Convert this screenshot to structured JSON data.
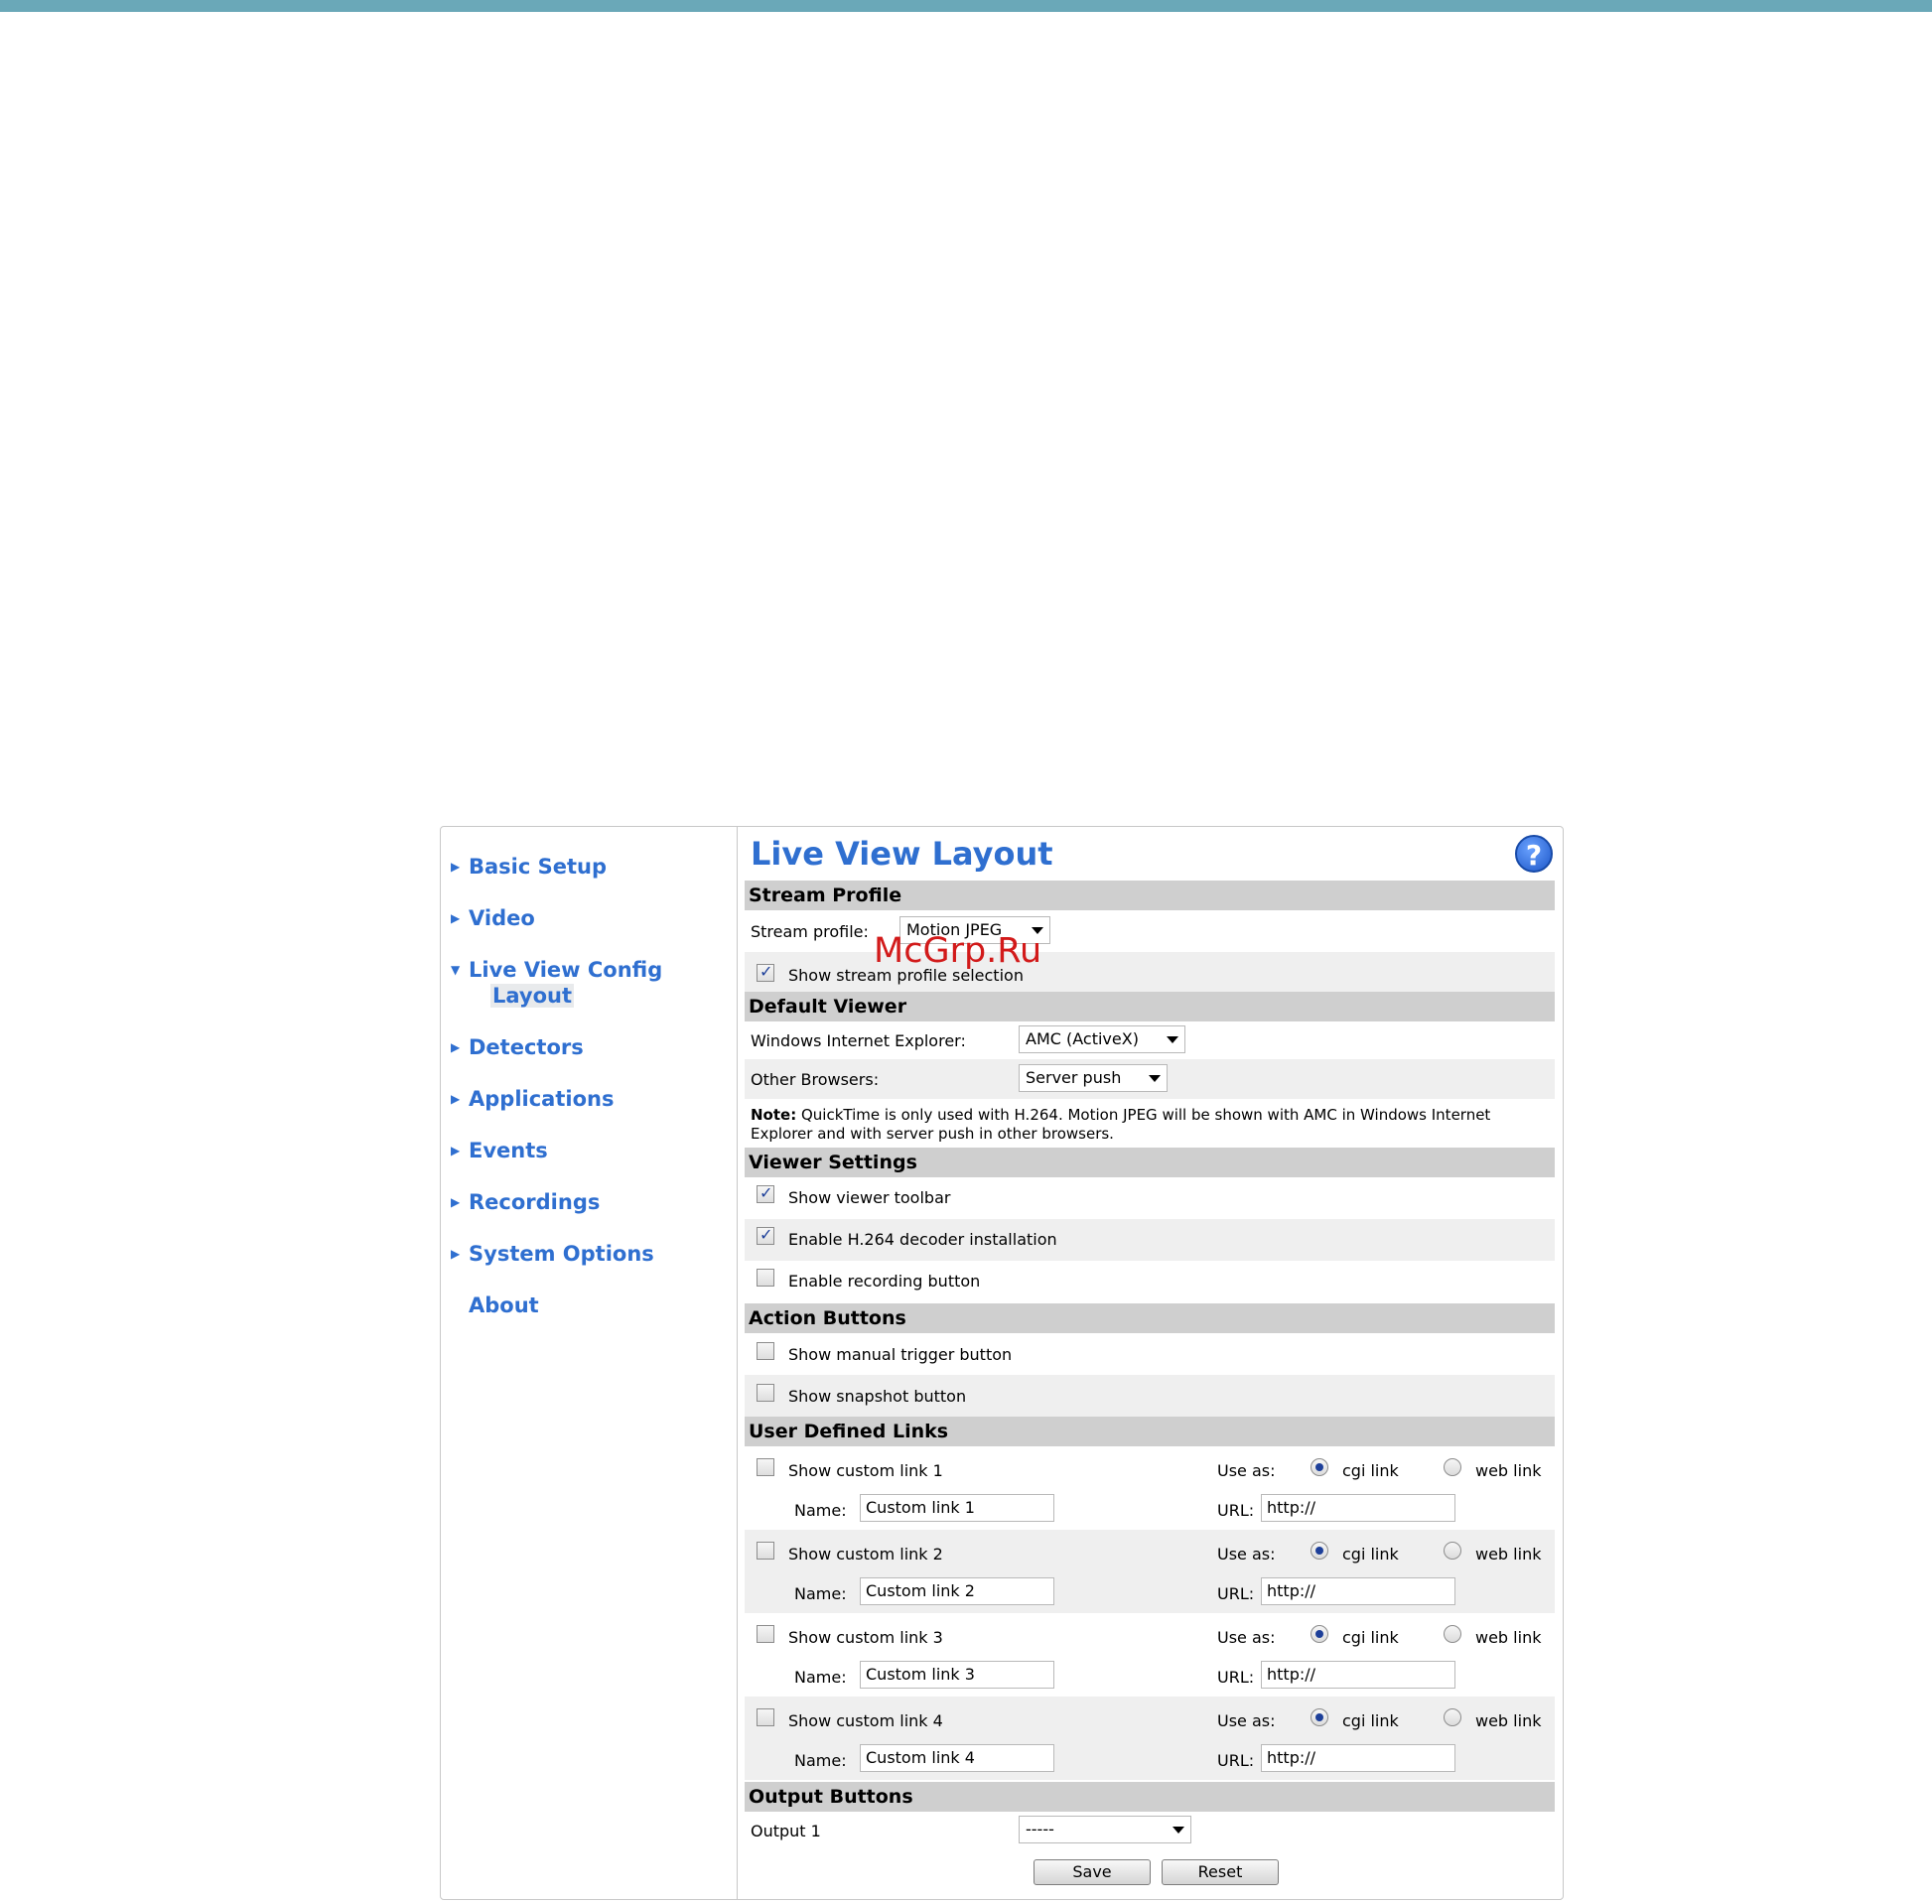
{
  "colors": {
    "accent": "#2f6fd0",
    "section_bg": "#cfcfcf",
    "top_bar": "#6aa8b8"
  },
  "sidebar": {
    "items": [
      {
        "label": "Basic Setup"
      },
      {
        "label": "Video"
      },
      {
        "label": "Live View Config",
        "sub": "Layout"
      },
      {
        "label": "Detectors"
      },
      {
        "label": "Applications"
      },
      {
        "label": "Events"
      },
      {
        "label": "Recordings"
      },
      {
        "label": "System Options"
      },
      {
        "label": "About"
      }
    ]
  },
  "page": {
    "title": "Live View Layout",
    "help_icon": "?"
  },
  "stream_profile": {
    "header": "Stream Profile",
    "label": "Stream profile:",
    "value": "Motion JPEG",
    "show_selection_label": "Show stream profile selection"
  },
  "default_viewer": {
    "header": "Default Viewer",
    "ie_label": "Windows Internet Explorer:",
    "ie_value": "AMC (ActiveX)",
    "other_label": "Other Browsers:",
    "other_value": "Server push",
    "note_bold": "Note:",
    "note_text": " QuickTime is only used with H.264. Motion JPEG will be shown with AMC in Windows Internet Explorer and with server push in other browsers."
  },
  "viewer_settings": {
    "header": "Viewer Settings",
    "toolbar_label": "Show viewer toolbar",
    "h264_label": "Enable H.264 decoder installation",
    "recording_label": "Enable recording button"
  },
  "action_buttons": {
    "header": "Action Buttons",
    "manual_trigger_label": "Show manual trigger button",
    "snapshot_label": "Show snapshot button"
  },
  "links": {
    "header": "User Defined Links",
    "use_as": "Use as:",
    "cgi": "cgi link",
    "web": "web link",
    "name_label": "Name:",
    "url_label": "URL:",
    "items": [
      {
        "show": "Show custom link 1",
        "name": "Custom link 1",
        "url": "http://"
      },
      {
        "show": "Show custom link 2",
        "name": "Custom link 2",
        "url": "http://"
      },
      {
        "show": "Show custom link 3",
        "name": "Custom link 3",
        "url": "http://"
      },
      {
        "show": "Show custom link 4",
        "name": "Custom link 4",
        "url": "http://"
      }
    ]
  },
  "output_buttons": {
    "header": "Output Buttons",
    "label": "Output 1",
    "value": "-----"
  },
  "buttons": {
    "save": "Save",
    "reset": "Reset"
  },
  "watermark": "McGrp.Ru"
}
